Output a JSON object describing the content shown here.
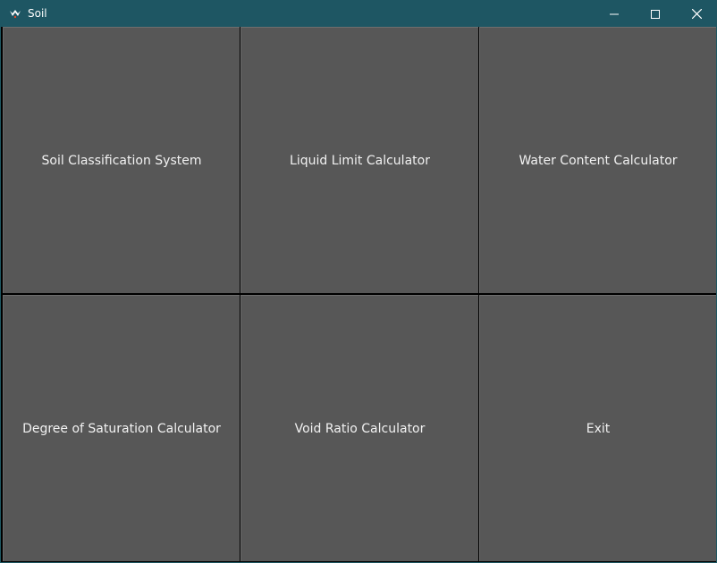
{
  "window": {
    "title": "Soil",
    "app_icon": "kivy-logo-icon",
    "controls": {
      "minimize_icon": "minimize-icon",
      "maximize_icon": "maximize-icon",
      "close_icon": "close-icon"
    }
  },
  "buttons": [
    {
      "id": "soil-classification",
      "label": "Soil Classification System"
    },
    {
      "id": "liquid-limit",
      "label": "Liquid Limit Calculator"
    },
    {
      "id": "water-content",
      "label": "Water Content Calculator"
    },
    {
      "id": "degree-of-saturation",
      "label": "Degree of Saturation Calculator"
    },
    {
      "id": "void-ratio",
      "label": "Void Ratio Calculator"
    },
    {
      "id": "exit",
      "label": "Exit"
    }
  ],
  "colors": {
    "titlebar": "#1e5663",
    "button_bg": "#575757",
    "button_text": "#f2f2f2",
    "grid_gap": "#000000"
  }
}
